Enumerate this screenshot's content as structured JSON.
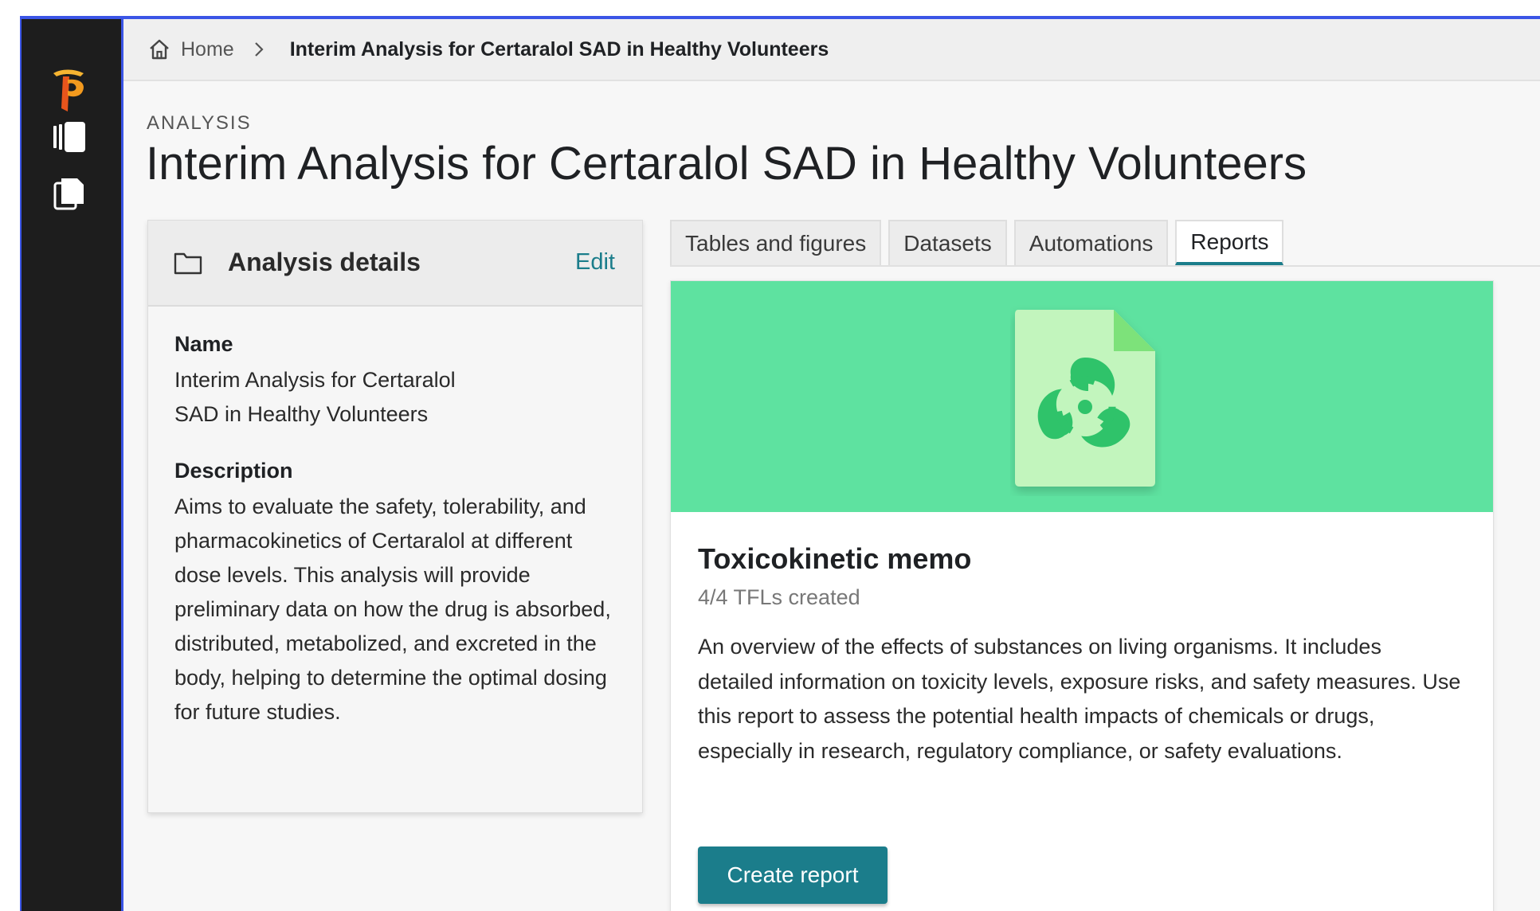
{
  "breadcrumb": {
    "home_label": "Home",
    "current": "Interim Analysis for Certaralol SAD in Healthy Volunteers"
  },
  "page": {
    "eyebrow": "ANALYSIS",
    "title": "Interim Analysis for Certaralol SAD in Healthy Volunteers"
  },
  "details": {
    "title": "Analysis details",
    "edit_label": "Edit",
    "name_label": "Name",
    "name_value": "Interim Analysis for Certaralol SAD in Healthy Volunteers",
    "description_label": "Description",
    "description_value": "Aims to evaluate the safety, tolerability, and pharmacokinetics of Certaralol at different dose levels. This analysis will provide preliminary data on how the drug is absorbed, distributed, metabolized, and excreted in the body, helping to determine the optimal dosing for future studies."
  },
  "tabs": [
    {
      "label": "Tables and figures",
      "active": false
    },
    {
      "label": "Datasets",
      "active": false
    },
    {
      "label": "Automations",
      "active": false
    },
    {
      "label": "Reports",
      "active": true
    }
  ],
  "report": {
    "title": "Toxicokinetic memo",
    "count": "4/4 TFLs created",
    "description": "An overview of the effects of substances on living organisms. It includes detailed information on toxicity levels, exposure risks, and safety measures. Use this report to assess the potential health impacts of chemicals or drugs, especially in research, regulatory compliance, or safety evaluations.",
    "button_label": "Create report",
    "icon": "biohazard-document-icon"
  },
  "colors": {
    "accent": "#1b7d8b",
    "banner": "#5ee2a0",
    "rail": "#1d1d1d",
    "logo": "#f39a1e"
  }
}
